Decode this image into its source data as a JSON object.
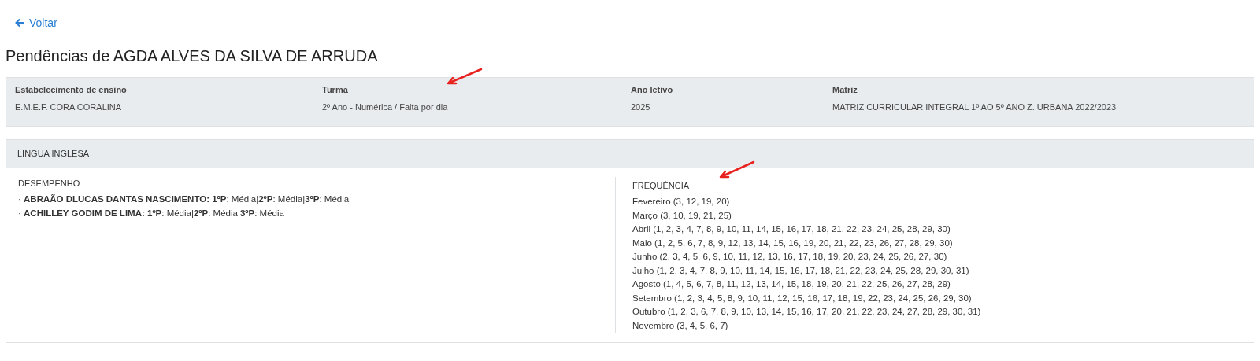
{
  "back_link": {
    "label": "Voltar"
  },
  "title": "Pendências de AGDA ALVES DA SILVA DE ARRUDA",
  "info": [
    {
      "label": "Estabelecimento de ensino",
      "value": "E.M.E.F. CORA CORALINA"
    },
    {
      "label": "Turma",
      "value": "2º Ano - Numérica / Falta por dia"
    },
    {
      "label": "Ano letivo",
      "value": "2025"
    },
    {
      "label": "Matriz",
      "value": "MATRIZ CURRICULAR INTEGRAL 1º AO 5º ANO Z. URBANA 2022/2023"
    }
  ],
  "subjects": [
    {
      "name": "LINGUA INGLESA",
      "performance": {
        "heading": "DESEMPENHO",
        "lines": [
          "· **ABRAÃO DLUCAS DANTAS NASCIMENTO: 1ºP**: Média|**2ºP**: Média|**3ºP**: Média",
          "· **ACHILLEY GODIM DE LIMA: 1ºP**: Média|**2ºP**: Média|**3ºP**: Média"
        ]
      },
      "attendance": {
        "heading": "FREQUÊNCIA",
        "lines": [
          "Fevereiro (3, 12, 19, 20)",
          "Março (3, 10, 19, 21, 25)",
          "Abril (1, 2, 3, 4, 7, 8, 9, 10, 11, 14, 15, 16, 17, 18, 21, 22, 23, 24, 25, 28, 29, 30)",
          "Maio (1, 2, 5, 6, 7, 8, 9, 12, 13, 14, 15, 16, 19, 20, 21, 22, 23, 26, 27, 28, 29, 30)",
          "Junho (2, 3, 4, 5, 6, 9, 10, 11, 12, 13, 16, 17, 18, 19, 20, 23, 24, 25, 26, 27, 30)",
          "Julho (1, 2, 3, 4, 7, 8, 9, 10, 11, 14, 15, 16, 17, 18, 21, 22, 23, 24, 25, 28, 29, 30, 31)",
          "Agosto (1, 4, 5, 6, 7, 8, 11, 12, 13, 14, 15, 18, 19, 20, 21, 22, 25, 26, 27, 28, 29)",
          "Setembro (1, 2, 3, 4, 5, 8, 9, 10, 11, 12, 15, 16, 17, 18, 19, 22, 23, 24, 25, 26, 29, 30)",
          "Outubro (1, 2, 3, 6, 7, 8, 9, 10, 13, 14, 15, 16, 17, 20, 21, 22, 23, 24, 27, 28, 29, 30, 31)",
          "Novembro (3, 4, 5, 6, 7)"
        ]
      }
    }
  ]
}
